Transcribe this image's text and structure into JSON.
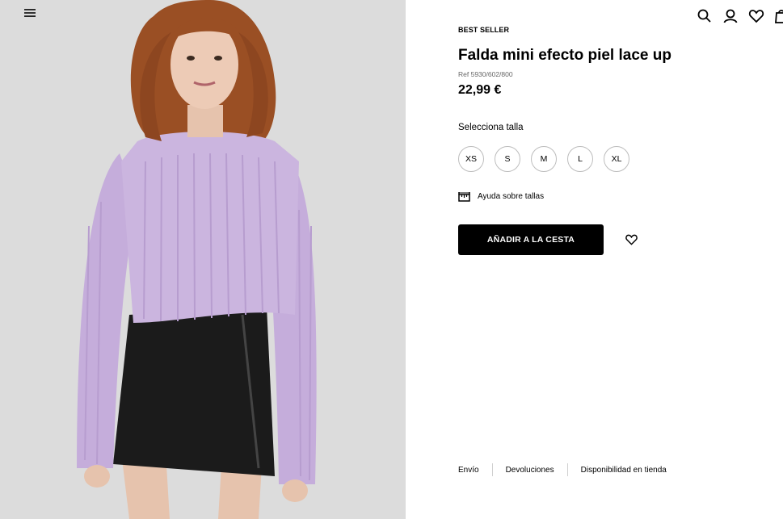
{
  "header": {
    "menu_icon": "hamburger-menu-icon",
    "icons": [
      "search-icon",
      "user-icon",
      "heart-icon",
      "bag-icon"
    ]
  },
  "product": {
    "badge": "BEST SELLER",
    "title": "Falda mini efecto piel lace up",
    "ref": "Ref 5930/602/800",
    "price": "22,99 €",
    "size_label": "Selecciona talla",
    "sizes": [
      "XS",
      "S",
      "M",
      "L",
      "XL"
    ],
    "size_help": "Ayuda sobre tallas",
    "add_to_cart": "AÑADIR A LA CESTA"
  },
  "footer": {
    "links": [
      "Envío",
      "Devoluciones",
      "Disponibilidad en tienda"
    ]
  },
  "colors": {
    "photo_bg": "#dcdcdc",
    "sweater": "#c9b3dd",
    "skirt": "#1b1b1b",
    "hair": "#9a4f24",
    "button_bg": "#000000"
  }
}
